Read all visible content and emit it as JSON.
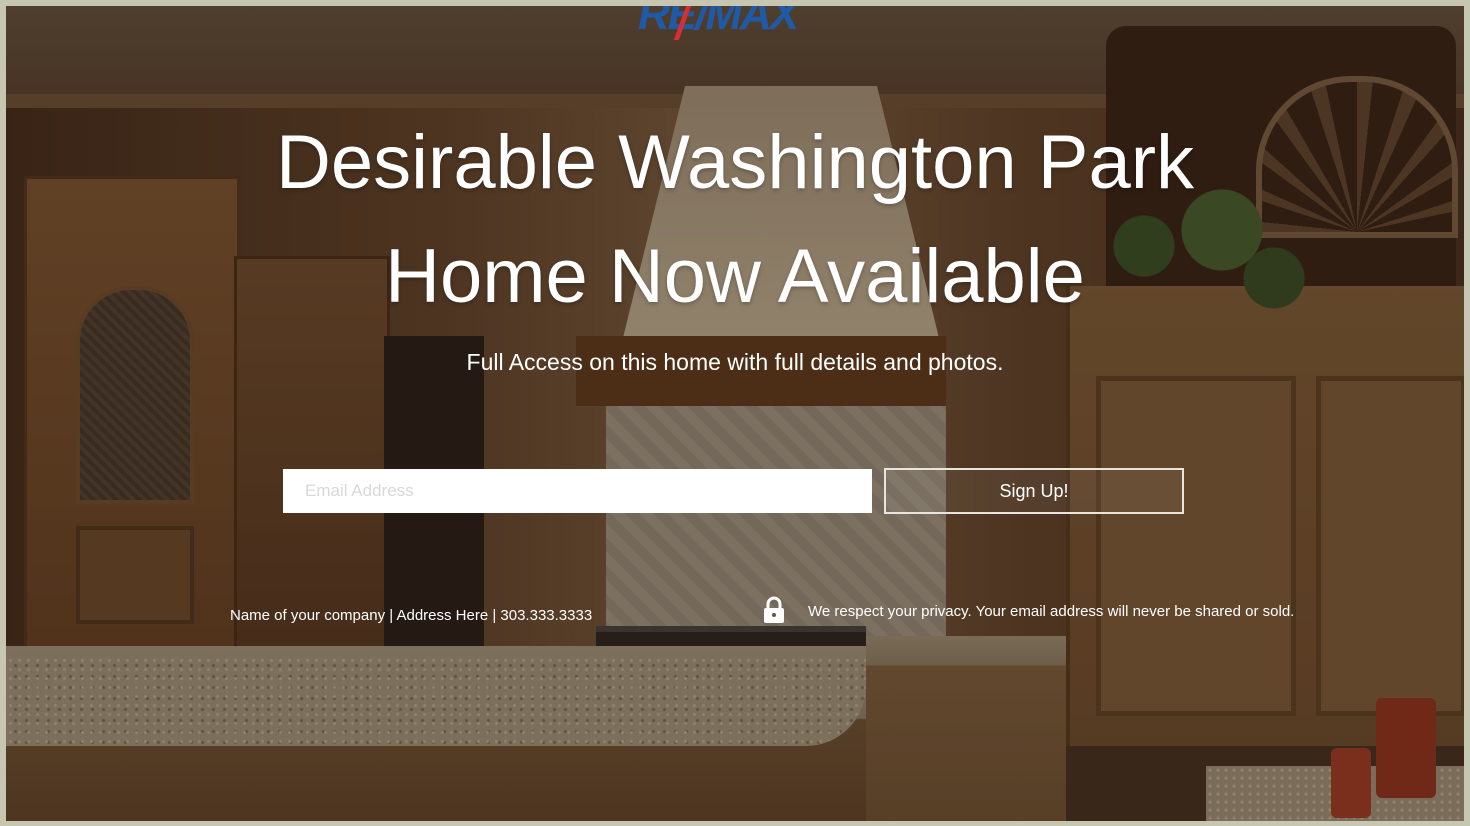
{
  "brand": {
    "logo_text": "RE/MAX",
    "colors": {
      "logo_blue": "#1f5aa8",
      "logo_red": "#d62f2f"
    }
  },
  "hero": {
    "headline_line1": "Desirable Washington Park",
    "headline_line2": "Home Now Available",
    "subheadline": "Full Access on this home with full details and photos.",
    "background": "kitchen-photo"
  },
  "signup_form": {
    "email_placeholder": "Email Address",
    "email_value": "",
    "submit_label": "Sign Up!"
  },
  "footer": {
    "company_info": "Name of your company | Address Here | 303.333.3333",
    "privacy_icon": "lock-icon",
    "privacy_text": "We respect your privacy. Your email address will never be shared or sold."
  }
}
